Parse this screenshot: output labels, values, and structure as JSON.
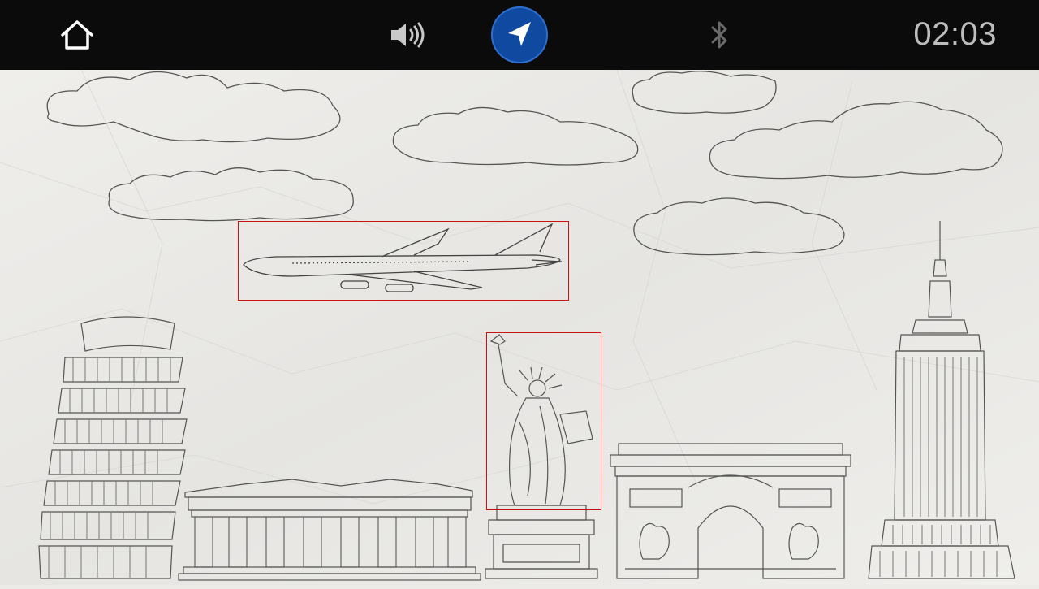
{
  "status_bar": {
    "time": "02:03",
    "icons": [
      "home-icon",
      "volume-icon",
      "navigation-arrow-icon",
      "bluetooth-icon"
    ],
    "nav_accent": "#0f4aa0"
  },
  "wallpaper": {
    "landmarks": [
      "leaning-tower-of-pisa",
      "parthenon",
      "statue-of-liberty",
      "arc-de-triomphe",
      "empire-state-building"
    ]
  },
  "highlights": {
    "color": "#cc1111",
    "targets": [
      "airplane",
      "statue-of-liberty"
    ]
  }
}
